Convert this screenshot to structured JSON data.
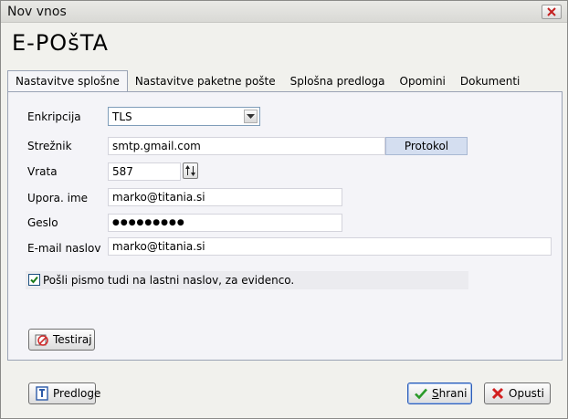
{
  "window": {
    "title": "Nov vnos"
  },
  "heading": "E-POšTA",
  "tabs": [
    {
      "label": "Nastavitve splošne",
      "active": true
    },
    {
      "label": "Nastavitve paketne pošte",
      "active": false
    },
    {
      "label": "Splošna predloga",
      "active": false
    },
    {
      "label": "Opomini",
      "active": false
    },
    {
      "label": "Dokumenti",
      "active": false
    }
  ],
  "form": {
    "encryption": {
      "label": "Enkripcija",
      "value": "TLS"
    },
    "server": {
      "label": "Strežnik",
      "value": "smtp.gmail.com",
      "protocol_button": "Protokol"
    },
    "port": {
      "label": "Vrata",
      "value": "587"
    },
    "username": {
      "label": "Upora. ime",
      "value": "marko@titania.si"
    },
    "password": {
      "label": "Geslo",
      "value": "●●●●●●●●●"
    },
    "email": {
      "label": "E-mail naslov",
      "value": "marko@titania.si"
    },
    "send_copy": {
      "label": "Pošli pismo tudi na lastni naslov, za evidenco.",
      "checked": true
    }
  },
  "buttons": {
    "test": "Testiraj",
    "templates": "Predloge",
    "save_prefix": "S",
    "save_rest": "hrani",
    "cancel": "Opusti"
  },
  "colors": {
    "accent": "#2d5db8",
    "protocol_bg": "#d4def0",
    "cancel_icon": "#d22020",
    "save_icon": "#2a9a2a"
  }
}
